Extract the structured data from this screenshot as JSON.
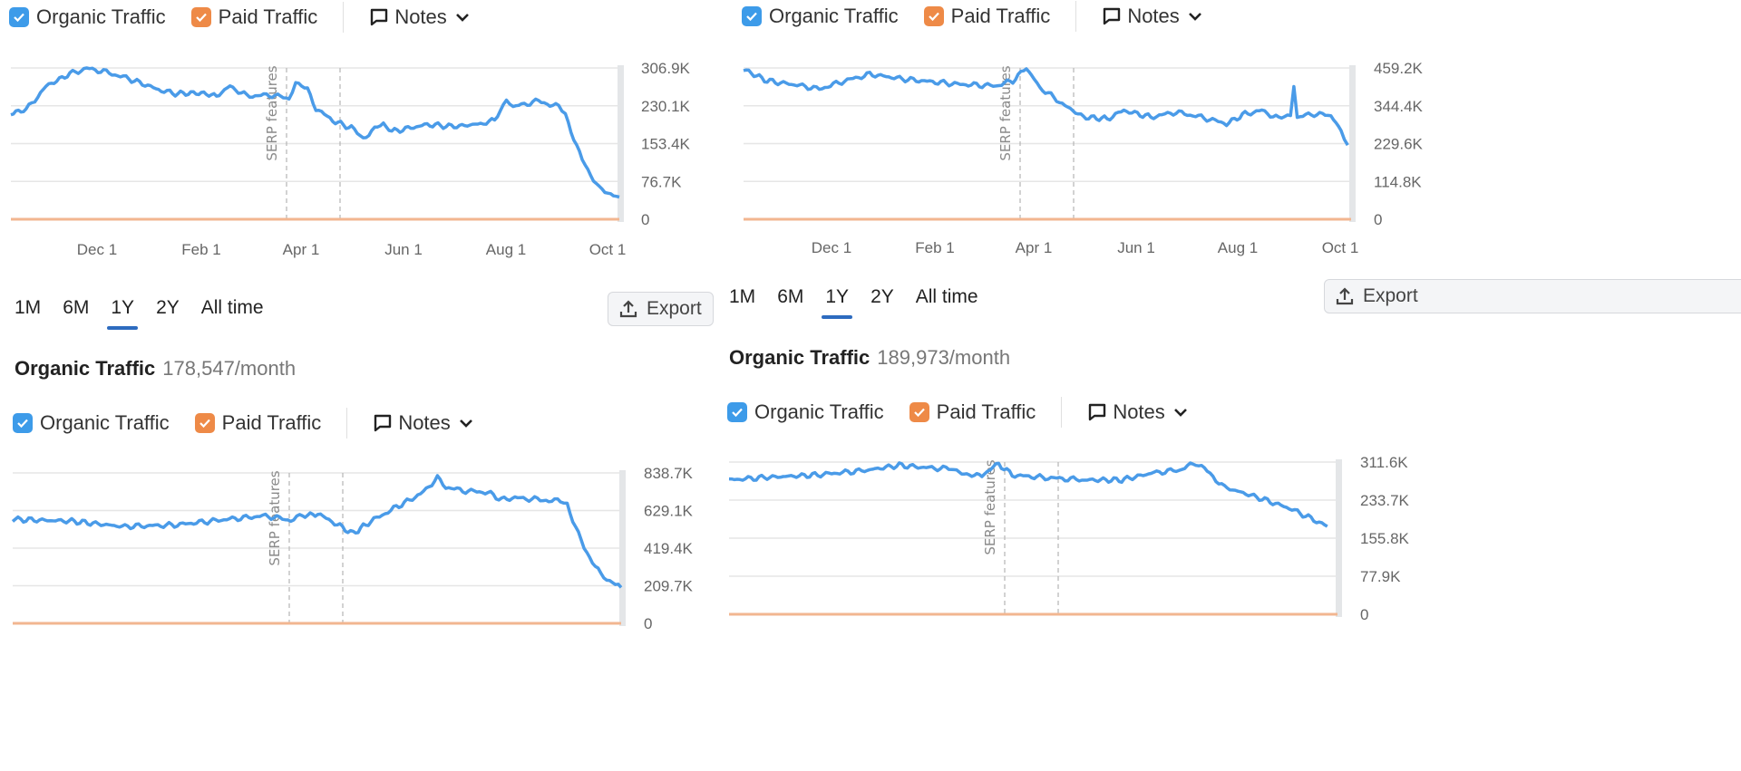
{
  "legend": {
    "organic": "Organic Traffic",
    "paid": "Paid Traffic",
    "notes": "Notes"
  },
  "range_tabs": [
    "1M",
    "6M",
    "1Y",
    "2Y",
    "All time"
  ],
  "active_range": "1Y",
  "export_label": "Export",
  "annotation_label": "SERP features",
  "colors": {
    "organic": "#4a9be8",
    "paid": "#ee8a47",
    "accent": "#2d6bbf"
  },
  "icons": {
    "checkbox": "check-icon",
    "notes": "speech-bubble-icon",
    "dropdown": "chevron-down-icon",
    "export": "upload-icon"
  },
  "panels": {
    "bottom_left_title": {
      "label": "Organic Traffic",
      "value": "178,547/month"
    },
    "bottom_right_title": {
      "label": "Organic Traffic",
      "value": "189,973/month"
    }
  },
  "chart_data": [
    {
      "type": "line",
      "series": [
        {
          "name": "Organic Traffic",
          "points": [
            [
              "2022-10-11",
              215
            ],
            [
              "2022-10-20",
              222
            ],
            [
              "2022-11-01",
              270
            ],
            [
              "2022-11-15",
              295
            ],
            [
              "2022-11-25",
              306
            ],
            [
              "2022-12-05",
              300
            ],
            [
              "2022-12-20",
              285
            ],
            [
              "2023-01-05",
              265
            ],
            [
              "2023-01-15",
              255
            ],
            [
              "2023-02-01",
              256
            ],
            [
              "2023-02-10",
              250
            ],
            [
              "2023-02-18",
              270
            ],
            [
              "2023-02-28",
              250
            ],
            [
              "2023-03-15",
              252
            ],
            [
              "2023-03-25",
              245
            ],
            [
              "2023-03-29",
              280
            ],
            [
              "2023-04-05",
              262
            ],
            [
              "2023-04-10",
              225
            ],
            [
              "2023-04-20",
              200
            ],
            [
              "2023-05-01",
              185
            ],
            [
              "2023-05-08",
              165
            ],
            [
              "2023-05-20",
              195
            ],
            [
              "2023-05-25",
              178
            ],
            [
              "2023-06-15",
              192
            ],
            [
              "2023-07-01",
              188
            ],
            [
              "2023-07-15",
              193
            ],
            [
              "2023-07-25",
              200
            ],
            [
              "2023-08-01",
              245
            ],
            [
              "2023-08-05",
              228
            ],
            [
              "2023-08-20",
              240
            ],
            [
              "2023-09-01",
              228
            ],
            [
              "2023-09-05",
              210
            ],
            [
              "2023-09-15",
              120
            ],
            [
              "2023-09-25",
              62
            ],
            [
              "2023-10-07",
              45
            ]
          ]
        },
        {
          "name": "Paid Traffic",
          "points": [
            [
              "2022-10-11",
              0
            ],
            [
              "2023-10-07",
              0
            ]
          ]
        }
      ],
      "x_ticks": [
        "Dec 1",
        "Feb 1",
        "Apr 1",
        "Jun 1",
        "Aug 1",
        "Oct 1"
      ],
      "y_ticks": [
        "306.9K",
        "230.1K",
        "153.4K",
        "76.7K",
        "0"
      ],
      "ylim": [
        0,
        306.9
      ],
      "unit": "K",
      "grid": true
    },
    {
      "type": "line",
      "series": [
        {
          "name": "Organic Traffic",
          "points": [
            [
              "2022-10-11",
              455
            ],
            [
              "2022-10-25",
              420
            ],
            [
              "2022-11-15",
              405
            ],
            [
              "2022-11-25",
              395
            ],
            [
              "2022-12-10",
              420
            ],
            [
              "2022-12-25",
              440
            ],
            [
              "2023-01-15",
              425
            ],
            [
              "2023-02-15",
              410
            ],
            [
              "2023-03-10",
              405
            ],
            [
              "2023-03-20",
              420
            ],
            [
              "2023-03-28",
              460
            ],
            [
              "2023-04-05",
              400
            ],
            [
              "2023-04-20",
              345
            ],
            [
              "2023-05-01",
              310
            ],
            [
              "2023-05-15",
              305
            ],
            [
              "2023-05-25",
              330
            ],
            [
              "2023-06-10",
              310
            ],
            [
              "2023-06-25",
              325
            ],
            [
              "2023-07-10",
              310
            ],
            [
              "2023-07-25",
              290
            ],
            [
              "2023-08-05",
              320
            ],
            [
              "2023-08-15",
              330
            ],
            [
              "2023-08-25",
              305
            ],
            [
              "2023-09-01",
              320
            ],
            [
              "2023-09-03",
              410
            ],
            [
              "2023-09-05",
              310
            ],
            [
              "2023-09-15",
              320
            ],
            [
              "2023-09-25",
              315
            ],
            [
              "2023-10-01",
              270
            ],
            [
              "2023-10-05",
              225
            ]
          ]
        },
        {
          "name": "Paid Traffic",
          "points": [
            [
              "2022-10-11",
              0
            ],
            [
              "2023-10-07",
              0
            ]
          ]
        }
      ],
      "x_ticks": [
        "Dec 1",
        "Feb 1",
        "Apr 1",
        "Jun 1",
        "Aug 1",
        "Oct 1"
      ],
      "y_ticks": [
        "459.2K",
        "344.4K",
        "229.6K",
        "114.8K",
        "0"
      ],
      "ylim": [
        0,
        459.2
      ],
      "unit": "K",
      "grid": true
    },
    {
      "type": "line",
      "series": [
        {
          "name": "Organic Traffic",
          "points": [
            [
              "2022-10-11",
              580
            ],
            [
              "2022-11-15",
              570
            ],
            [
              "2022-12-15",
              540
            ],
            [
              "2023-01-15",
              548
            ],
            [
              "2023-02-15",
              580
            ],
            [
              "2023-03-10",
              600
            ],
            [
              "2023-03-25",
              575
            ],
            [
              "2023-04-01",
              600
            ],
            [
              "2023-04-10",
              610
            ],
            [
              "2023-04-20",
              560
            ],
            [
              "2023-05-01",
              500
            ],
            [
              "2023-05-10",
              560
            ],
            [
              "2023-05-25",
              640
            ],
            [
              "2023-06-10",
              720
            ],
            [
              "2023-06-20",
              810
            ],
            [
              "2023-06-25",
              760
            ],
            [
              "2023-07-05",
              740
            ],
            [
              "2023-07-20",
              730
            ],
            [
              "2023-07-28",
              690
            ],
            [
              "2023-08-05",
              700
            ],
            [
              "2023-08-20",
              690
            ],
            [
              "2023-09-01",
              680
            ],
            [
              "2023-09-05",
              660
            ],
            [
              "2023-09-15",
              420
            ],
            [
              "2023-09-25",
              270
            ],
            [
              "2023-10-07",
              200
            ]
          ]
        },
        {
          "name": "Paid Traffic",
          "points": [
            [
              "2022-10-11",
              0
            ],
            [
              "2023-10-07",
              0
            ]
          ]
        }
      ],
      "x_ticks": [],
      "y_ticks": [
        "838.7K",
        "629.1K",
        "419.4K",
        "209.7K",
        "0"
      ],
      "ylim": [
        0,
        838.7
      ],
      "unit": "K",
      "grid": true
    },
    {
      "type": "line",
      "series": [
        {
          "name": "Organic Traffic",
          "points": [
            [
              "2022-10-11",
              275
            ],
            [
              "2022-11-01",
              280
            ],
            [
              "2022-12-01",
              285
            ],
            [
              "2023-01-01",
              295
            ],
            [
              "2023-01-20",
              305
            ],
            [
              "2023-02-05",
              300
            ],
            [
              "2023-02-20",
              298
            ],
            [
              "2023-03-01",
              285
            ],
            [
              "2023-03-10",
              285
            ],
            [
              "2023-03-20",
              308
            ],
            [
              "2023-03-28",
              285
            ],
            [
              "2023-04-15",
              280
            ],
            [
              "2023-05-10",
              275
            ],
            [
              "2023-06-01",
              275
            ],
            [
              "2023-06-20",
              290
            ],
            [
              "2023-07-05",
              295
            ],
            [
              "2023-07-15",
              310
            ],
            [
              "2023-07-20",
              298
            ],
            [
              "2023-08-01",
              260
            ],
            [
              "2023-08-20",
              240
            ],
            [
              "2023-09-10",
              215
            ],
            [
              "2023-10-01",
              180
            ]
          ]
        },
        {
          "name": "Paid Traffic",
          "points": [
            [
              "2022-10-11",
              0
            ],
            [
              "2023-10-07",
              0
            ]
          ]
        }
      ],
      "x_ticks": [],
      "y_ticks": [
        "311.6K",
        "233.7K",
        "155.8K",
        "77.9K",
        "0"
      ],
      "ylim": [
        0,
        311.6
      ],
      "unit": "K",
      "grid": true
    }
  ]
}
